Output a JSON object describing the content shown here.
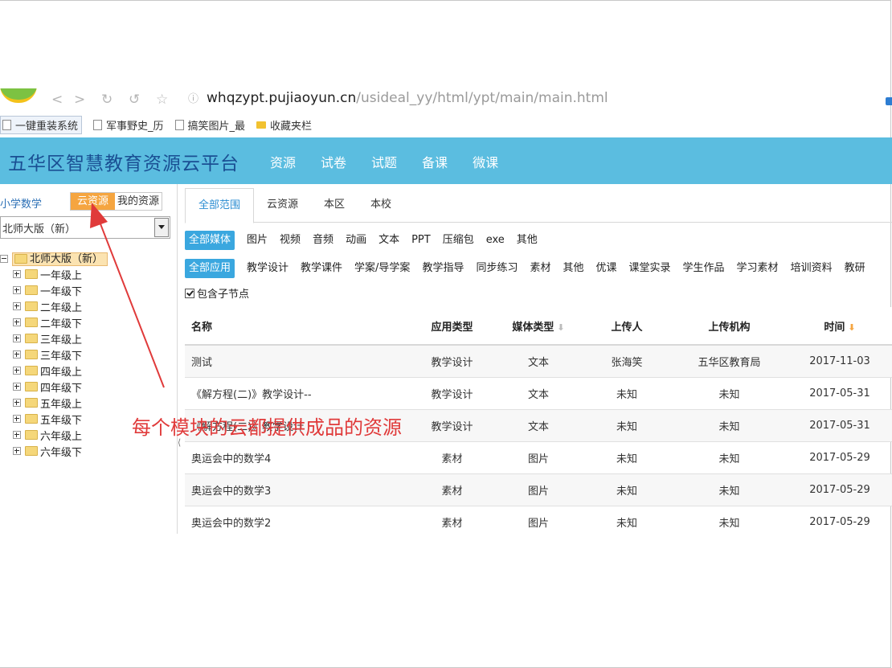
{
  "browser": {
    "url_domain": "whqzypt.pujiaoyun.cn",
    "url_path": "/usideal_yy/html/ypt/main/main.html",
    "bookmarks": [
      {
        "label": "一键重装系统",
        "icon": "page-icon",
        "active": true
      },
      {
        "label": "军事野史_历",
        "icon": "page-icon",
        "active": false
      },
      {
        "label": "搞笑图片_最",
        "icon": "page-icon",
        "active": false
      },
      {
        "label": "收藏夹栏",
        "icon": "folder-icon",
        "active": false
      }
    ]
  },
  "header": {
    "site_title": "五华区智慧教育资源云平台",
    "nav": [
      "资源",
      "试卷",
      "试题",
      "备课",
      "微课"
    ],
    "bg_color": "#5bbde0"
  },
  "sidebar": {
    "subject": "小学数学",
    "source_cloud": "云资源",
    "source_mine": "我的资源",
    "edition_selected": "北师大版（新）",
    "tree_root": "北师大版（新）",
    "tree_items": [
      "一年级上",
      "一年级下",
      "二年级上",
      "二年级下",
      "三年级上",
      "三年级下",
      "四年级上",
      "四年级下",
      "五年级上",
      "五年级下",
      "六年级上",
      "六年级下"
    ]
  },
  "main": {
    "scope_tabs": [
      "全部范围",
      "云资源",
      "本区",
      "本校"
    ],
    "media_filters": [
      "全部媒体",
      "图片",
      "视频",
      "音频",
      "动画",
      "文本",
      "PPT",
      "压缩包",
      "exe",
      "其他"
    ],
    "app_filters": [
      "全部应用",
      "教学设计",
      "教学课件",
      "学案/导学案",
      "教学指导",
      "同步练习",
      "素材",
      "其他",
      "优课",
      "课堂实录",
      "学生作品",
      "学习素材",
      "培训资料",
      "教研"
    ],
    "include_children_label": "包含子节点",
    "table": {
      "headers": [
        "名称",
        "应用类型",
        "媒体类型",
        "上传人",
        "上传机构",
        "时间"
      ],
      "rows": [
        [
          "测试",
          "教学设计",
          "文本",
          "张海笑",
          "五华区教育局",
          "2017-11-03"
        ],
        [
          "《解方程(二)》教学设计--",
          "教学设计",
          "文本",
          "未知",
          "未知",
          "2017-05-31"
        ],
        [
          "《解方程(二)》教学设计",
          "教学设计",
          "文本",
          "未知",
          "未知",
          "2017-05-31"
        ],
        [
          "奥运会中的数学4",
          "素材",
          "图片",
          "未知",
          "未知",
          "2017-05-29"
        ],
        [
          "奥运会中的数学3",
          "素材",
          "图片",
          "未知",
          "未知",
          "2017-05-29"
        ],
        [
          "奥运会中的数学2",
          "素材",
          "图片",
          "未知",
          "未知",
          "2017-05-29"
        ]
      ]
    }
  },
  "annotation": {
    "text": "每个模块的云都提供成品的资源",
    "color": "#e03a3a"
  }
}
